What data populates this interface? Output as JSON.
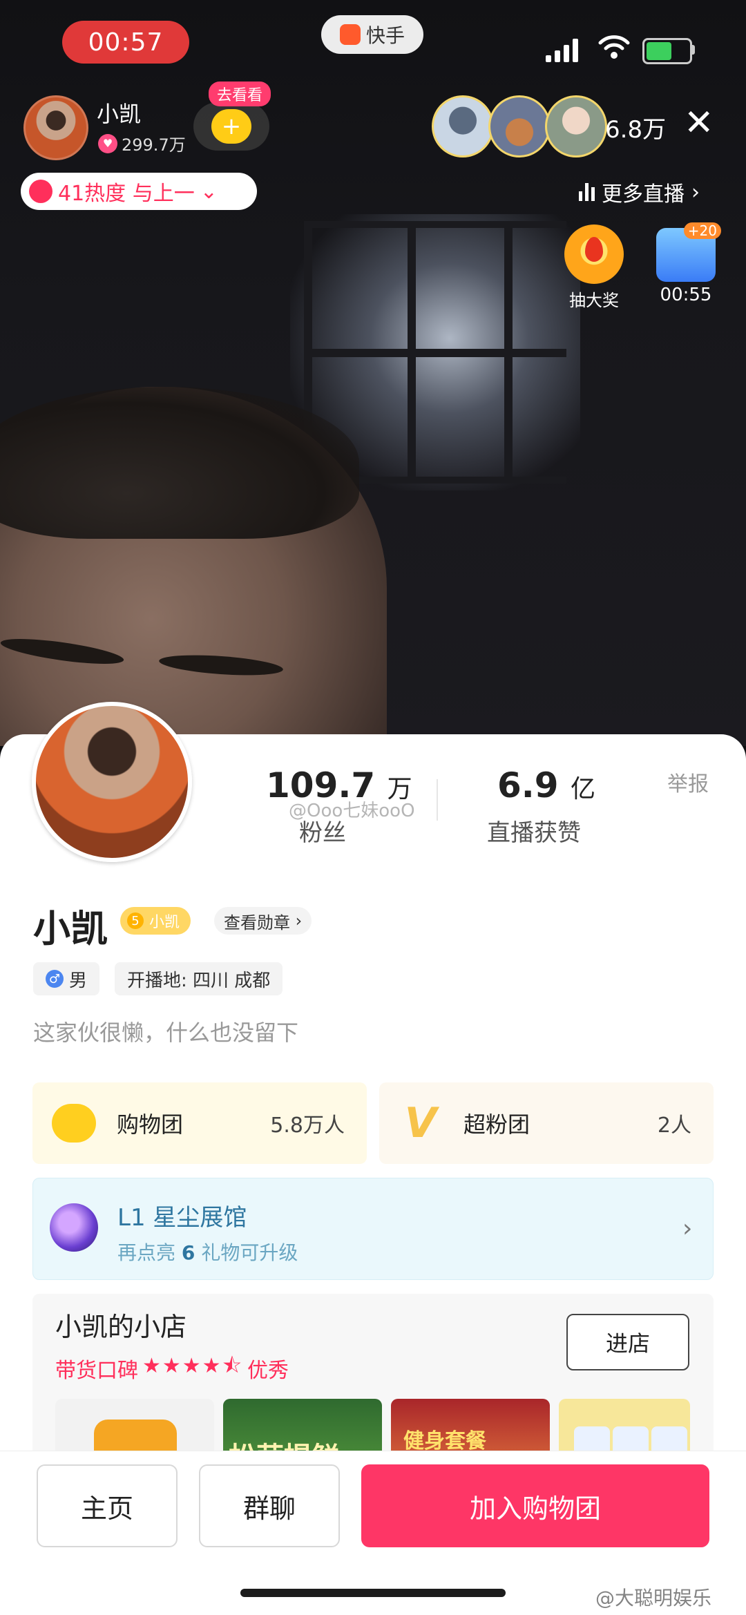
{
  "status_bar": {
    "time": "00:57",
    "app_name": "快手"
  },
  "live_header": {
    "host_name": "小凯",
    "host_likes": "299.7万",
    "follow_tag": "去看看",
    "viewer_count": "6.8万",
    "close_glyph": "✕",
    "heat_text": "41热度  与上一",
    "more_live": "更多直播"
  },
  "widgets": {
    "lottery_label": "抽大奖",
    "popular_badge": "+20",
    "popular_timer": "00:55"
  },
  "profile": {
    "fans_value": "109.7",
    "fans_unit": "万",
    "fans_label": "粉丝",
    "likes_value": "6.9",
    "likes_unit": "亿",
    "likes_label": "直播获赞",
    "report": "举报",
    "name": "小凯",
    "level_number": "5",
    "level_name": "小凯",
    "medal_link": "查看勋章",
    "gender_symbol": "♂",
    "gender": "男",
    "location": "开播地: 四川 成都",
    "bio": "这家伙很懒，什么也没留下"
  },
  "groups": {
    "shop_label": "购物团",
    "shop_count": "5.8万人",
    "fan_label": "超粉团",
    "fan_count": "2人"
  },
  "gallery": {
    "title": "L1 星尘展馆",
    "sub_prefix": "再点亮",
    "sub_number": "6",
    "sub_suffix": "礼物可升级"
  },
  "store": {
    "title": "小凯的小店",
    "rating_label": "带货口碑",
    "rating_stars": 4.5,
    "rating_text": "优秀",
    "enter_button": "进店",
    "product_2_text": "松茸提鲜",
    "product_3_text": "健身套餐"
  },
  "bottom_bar": {
    "home": "主页",
    "group_chat": "群聊",
    "join": "加入购物团"
  },
  "watermarks": {
    "center": "@Ooo七妹ooO",
    "bottom": "@大聪明娱乐"
  },
  "colors": {
    "accent": "#fe3666",
    "status_red": "#e03939",
    "gold": "#ffcc16",
    "gallery_blue": "#2e76a0"
  }
}
